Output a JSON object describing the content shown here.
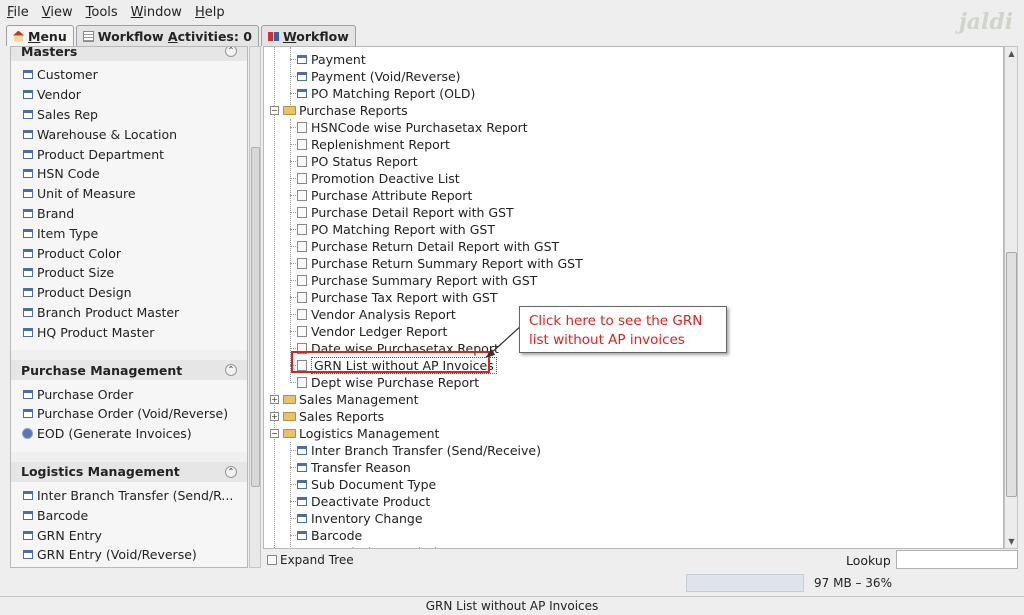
{
  "menubar": {
    "items": [
      "File",
      "View",
      "Tools",
      "Window",
      "Help"
    ],
    "mnemonics": [
      "F",
      "V",
      "T",
      "W",
      "H"
    ]
  },
  "logo_text": "jaldi",
  "tabs": [
    {
      "label": "Menu",
      "mnemonic": "M",
      "icon": "home-icon"
    },
    {
      "label": "Workflow Activities: 0",
      "mnemonic": "A",
      "icon": "list-icon"
    },
    {
      "label": "Workflow",
      "mnemonic": "W",
      "icon": "workflow-icon"
    }
  ],
  "left_panel": {
    "sections": [
      {
        "title": "Masters",
        "items": [
          "Customer",
          "Vendor",
          "Sales Rep",
          "Warehouse & Location",
          "Product Department",
          "HSN Code",
          "Unit of Measure",
          "Brand",
          "Item Type",
          "Product Color",
          "Product Size",
          "Product Design",
          "Branch Product Master",
          "HQ Product Master"
        ]
      },
      {
        "title": "Purchase Management",
        "items": [
          "Purchase Order",
          "Purchase Order (Void/Reverse)",
          "EOD (Generate Invoices)"
        ]
      },
      {
        "title": "Logistics Management",
        "items": [
          "Inter Branch Transfer (Send/R...",
          "Barcode",
          "GRN Entry",
          "GRN Entry (Void/Reverse)"
        ]
      }
    ]
  },
  "tree": {
    "payment_items": [
      "Payment",
      "Payment (Void/Reverse)",
      "PO Matching Report (OLD)"
    ],
    "purchase_reports_label": "Purchase Reports",
    "purchase_reports": [
      "HSNCode wise Purchasetax Report",
      "Replenishment Report",
      "PO Status Report",
      "Promotion Deactive List",
      "Purchase Attribute Report",
      "Purchase Detail Report with GST",
      "PO Matching Report with GST",
      "Purchase Return Detail Report with GST",
      "Purchase Return Summary Report with GST",
      "Purchase Summary Report with GST",
      "Purchase Tax Report with GST",
      "Vendor Analysis Report",
      "Vendor Ledger Report",
      "Date wise Purchasetax Report",
      "GRN List without AP Invoices",
      "Dept wise Purchase Report"
    ],
    "sales_management": "Sales Management",
    "sales_reports": "Sales Reports",
    "logistics_management": "Logistics Management",
    "logistics_items": [
      "Inter Branch Transfer (Send/Receive)",
      "Transfer Reason",
      "Sub Document Type",
      "Deactivate Product",
      "Inventory Change",
      "Barcode",
      "Barcode (SET Order)"
    ]
  },
  "callout": {
    "line1": "Click here to see the GRN",
    "line2": "list without AP invoices",
    "color": "#e02020"
  },
  "bottom": {
    "expand_tree_label": "Expand Tree",
    "lookup_label": "Lookup",
    "lookup_value": ""
  },
  "memory": "97 MB – 36%",
  "status_text": "GRN List without AP Invoices"
}
